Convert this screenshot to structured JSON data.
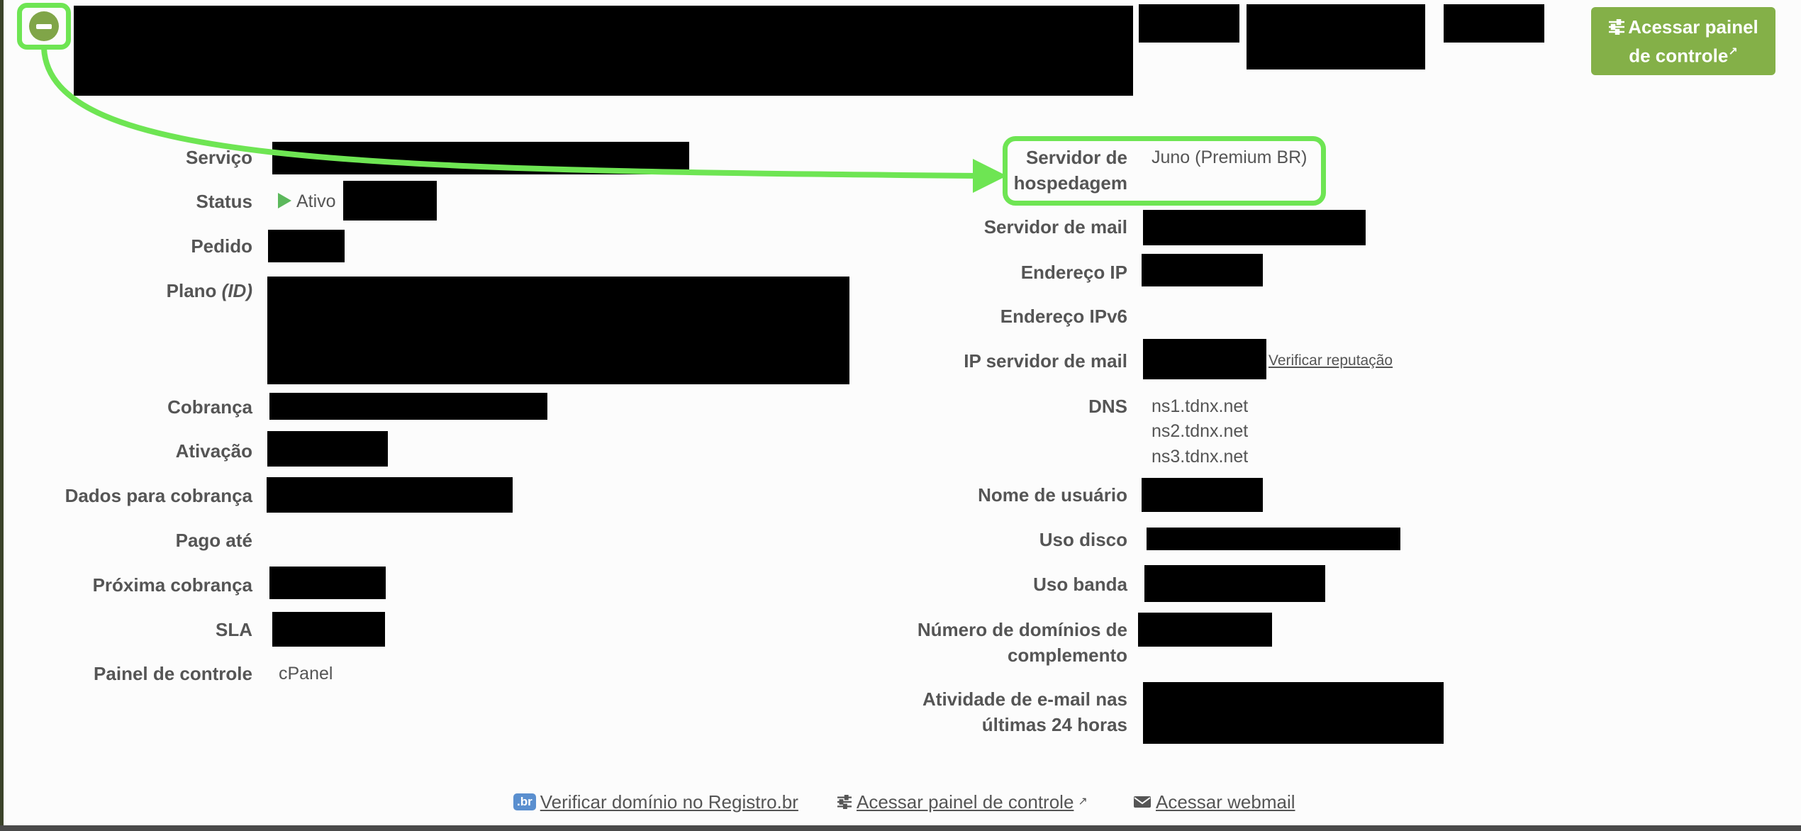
{
  "header": {
    "collapse_icon": "minus-circle-icon",
    "panel_button_label": "Acessar painel de controle",
    "panel_button_icon": "sliders-icon",
    "external_icon": "external-link-icon"
  },
  "left": [
    {
      "label": "Serviço",
      "value": ""
    },
    {
      "label": "Status",
      "value": "Ativo",
      "icon": "play-triangle-icon"
    },
    {
      "label": "Pedido",
      "value": ""
    },
    {
      "label": "Plano",
      "label_suffix": "(ID)",
      "value": ""
    },
    {
      "label": "Cobrança",
      "value": ""
    },
    {
      "label": "Ativação",
      "value": ""
    },
    {
      "label": "Dados para cobrança",
      "value": ""
    },
    {
      "label": "Pago até",
      "value": ""
    },
    {
      "label": "Próxima cobrança",
      "value": ""
    },
    {
      "label": "SLA",
      "value": ""
    },
    {
      "label": "Painel de controle",
      "value": "cPanel"
    }
  ],
  "right": {
    "hosting_server_label_1": "Servidor de",
    "hosting_server_label_2": "hospedagem",
    "hosting_server_value": "Juno (Premium BR)",
    "mail_server_label": "Servidor de mail",
    "ip_label": "Endereço IP",
    "ipv6_label": "Endereço IPv6",
    "mail_ip_label": "IP servidor de mail",
    "check_reputation": "Verificar reputação",
    "dns_label": "DNS",
    "dns_values": [
      "ns1.tdnx.net",
      "ns2.tdnx.net",
      "ns3.tdnx.net"
    ],
    "username_label": "Nome de usuário",
    "disk_label": "Uso disco",
    "bandwidth_label": "Uso banda",
    "addon_domains_label_1": "Número de domínios de",
    "addon_domains_label_2": "complemento",
    "email_activity_label_1": "Atividade de e-mail nas",
    "email_activity_label_2": "últimas 24 horas"
  },
  "footer": {
    "registro_badge": ".br",
    "registro_link": "Verificar domínio no Registro.br",
    "panel_link": "Acessar painel de controle",
    "panel_icon": "sliders-icon",
    "webmail_link": "Acessar webmail",
    "webmail_icon": "envelope-icon"
  },
  "colors": {
    "accent_green": "#84b048",
    "highlight_green": "#6ee553",
    "status_green": "#5cb85c"
  }
}
